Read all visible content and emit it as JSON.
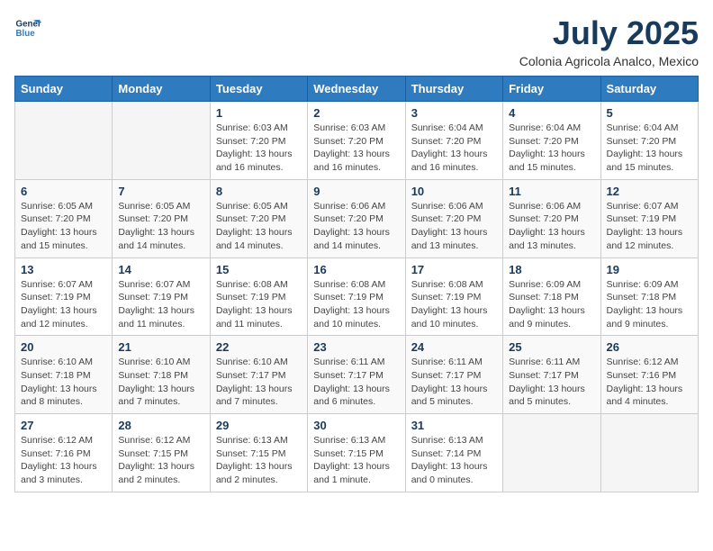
{
  "logo": {
    "line1": "General",
    "line2": "Blue"
  },
  "title": "July 2025",
  "subtitle": "Colonia Agricola Analco, Mexico",
  "days_header": [
    "Sunday",
    "Monday",
    "Tuesday",
    "Wednesday",
    "Thursday",
    "Friday",
    "Saturday"
  ],
  "weeks": [
    [
      {
        "day": "",
        "info": ""
      },
      {
        "day": "",
        "info": ""
      },
      {
        "day": "1",
        "info": "Sunrise: 6:03 AM\nSunset: 7:20 PM\nDaylight: 13 hours\nand 16 minutes."
      },
      {
        "day": "2",
        "info": "Sunrise: 6:03 AM\nSunset: 7:20 PM\nDaylight: 13 hours\nand 16 minutes."
      },
      {
        "day": "3",
        "info": "Sunrise: 6:04 AM\nSunset: 7:20 PM\nDaylight: 13 hours\nand 16 minutes."
      },
      {
        "day": "4",
        "info": "Sunrise: 6:04 AM\nSunset: 7:20 PM\nDaylight: 13 hours\nand 15 minutes."
      },
      {
        "day": "5",
        "info": "Sunrise: 6:04 AM\nSunset: 7:20 PM\nDaylight: 13 hours\nand 15 minutes."
      }
    ],
    [
      {
        "day": "6",
        "info": "Sunrise: 6:05 AM\nSunset: 7:20 PM\nDaylight: 13 hours\nand 15 minutes."
      },
      {
        "day": "7",
        "info": "Sunrise: 6:05 AM\nSunset: 7:20 PM\nDaylight: 13 hours\nand 14 minutes."
      },
      {
        "day": "8",
        "info": "Sunrise: 6:05 AM\nSunset: 7:20 PM\nDaylight: 13 hours\nand 14 minutes."
      },
      {
        "day": "9",
        "info": "Sunrise: 6:06 AM\nSunset: 7:20 PM\nDaylight: 13 hours\nand 14 minutes."
      },
      {
        "day": "10",
        "info": "Sunrise: 6:06 AM\nSunset: 7:20 PM\nDaylight: 13 hours\nand 13 minutes."
      },
      {
        "day": "11",
        "info": "Sunrise: 6:06 AM\nSunset: 7:20 PM\nDaylight: 13 hours\nand 13 minutes."
      },
      {
        "day": "12",
        "info": "Sunrise: 6:07 AM\nSunset: 7:19 PM\nDaylight: 13 hours\nand 12 minutes."
      }
    ],
    [
      {
        "day": "13",
        "info": "Sunrise: 6:07 AM\nSunset: 7:19 PM\nDaylight: 13 hours\nand 12 minutes."
      },
      {
        "day": "14",
        "info": "Sunrise: 6:07 AM\nSunset: 7:19 PM\nDaylight: 13 hours\nand 11 minutes."
      },
      {
        "day": "15",
        "info": "Sunrise: 6:08 AM\nSunset: 7:19 PM\nDaylight: 13 hours\nand 11 minutes."
      },
      {
        "day": "16",
        "info": "Sunrise: 6:08 AM\nSunset: 7:19 PM\nDaylight: 13 hours\nand 10 minutes."
      },
      {
        "day": "17",
        "info": "Sunrise: 6:08 AM\nSunset: 7:19 PM\nDaylight: 13 hours\nand 10 minutes."
      },
      {
        "day": "18",
        "info": "Sunrise: 6:09 AM\nSunset: 7:18 PM\nDaylight: 13 hours\nand 9 minutes."
      },
      {
        "day": "19",
        "info": "Sunrise: 6:09 AM\nSunset: 7:18 PM\nDaylight: 13 hours\nand 9 minutes."
      }
    ],
    [
      {
        "day": "20",
        "info": "Sunrise: 6:10 AM\nSunset: 7:18 PM\nDaylight: 13 hours\nand 8 minutes."
      },
      {
        "day": "21",
        "info": "Sunrise: 6:10 AM\nSunset: 7:18 PM\nDaylight: 13 hours\nand 7 minutes."
      },
      {
        "day": "22",
        "info": "Sunrise: 6:10 AM\nSunset: 7:17 PM\nDaylight: 13 hours\nand 7 minutes."
      },
      {
        "day": "23",
        "info": "Sunrise: 6:11 AM\nSunset: 7:17 PM\nDaylight: 13 hours\nand 6 minutes."
      },
      {
        "day": "24",
        "info": "Sunrise: 6:11 AM\nSunset: 7:17 PM\nDaylight: 13 hours\nand 5 minutes."
      },
      {
        "day": "25",
        "info": "Sunrise: 6:11 AM\nSunset: 7:17 PM\nDaylight: 13 hours\nand 5 minutes."
      },
      {
        "day": "26",
        "info": "Sunrise: 6:12 AM\nSunset: 7:16 PM\nDaylight: 13 hours\nand 4 minutes."
      }
    ],
    [
      {
        "day": "27",
        "info": "Sunrise: 6:12 AM\nSunset: 7:16 PM\nDaylight: 13 hours\nand 3 minutes."
      },
      {
        "day": "28",
        "info": "Sunrise: 6:12 AM\nSunset: 7:15 PM\nDaylight: 13 hours\nand 2 minutes."
      },
      {
        "day": "29",
        "info": "Sunrise: 6:13 AM\nSunset: 7:15 PM\nDaylight: 13 hours\nand 2 minutes."
      },
      {
        "day": "30",
        "info": "Sunrise: 6:13 AM\nSunset: 7:15 PM\nDaylight: 13 hours\nand 1 minute."
      },
      {
        "day": "31",
        "info": "Sunrise: 6:13 AM\nSunset: 7:14 PM\nDaylight: 13 hours\nand 0 minutes."
      },
      {
        "day": "",
        "info": ""
      },
      {
        "day": "",
        "info": ""
      }
    ]
  ]
}
